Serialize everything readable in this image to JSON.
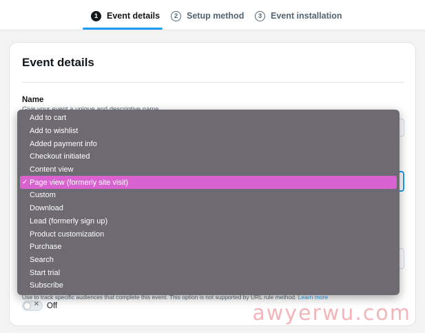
{
  "stepper": {
    "steps": [
      {
        "number": "1",
        "label": "Event details",
        "state": "active"
      },
      {
        "number": "2",
        "label": "Setup method",
        "state": "inactive"
      },
      {
        "number": "3",
        "label": "Event installation",
        "state": "inactive"
      }
    ]
  },
  "card": {
    "title": "Event details",
    "name_field": {
      "label": "Name",
      "help": "Give your event a unique and descriptive name"
    },
    "audience_help": "Use to track specific audiences that complete this event. This option is not supported by URL rule method.",
    "audience_help_link": "Learn more",
    "toggle": {
      "state": "Off",
      "icon": "close-icon"
    }
  },
  "dropdown": {
    "options": [
      {
        "label": "Add to cart",
        "selected": false
      },
      {
        "label": "Add to wishlist",
        "selected": false
      },
      {
        "label": "Added payment info",
        "selected": false
      },
      {
        "label": "Checkout initiated",
        "selected": false
      },
      {
        "label": "Content view",
        "selected": false
      },
      {
        "label": "Page view (formerly site visit)",
        "selected": true
      },
      {
        "label": "Custom",
        "selected": false
      },
      {
        "label": "Download",
        "selected": false
      },
      {
        "label": "Lead (formerly sign up)",
        "selected": false
      },
      {
        "label": "Product customization",
        "selected": false
      },
      {
        "label": "Purchase",
        "selected": false
      },
      {
        "label": "Search",
        "selected": false
      },
      {
        "label": "Start trial",
        "selected": false
      },
      {
        "label": "Subscribe",
        "selected": false
      }
    ],
    "check_glyph": "✓"
  },
  "watermark": "awyerwu.com",
  "colors": {
    "accent": "#1d9bf0",
    "dropdown_bg": "#6e6a71",
    "selected_bg": "#d762d0",
    "text_primary": "#14171a",
    "text_secondary": "#536471"
  }
}
